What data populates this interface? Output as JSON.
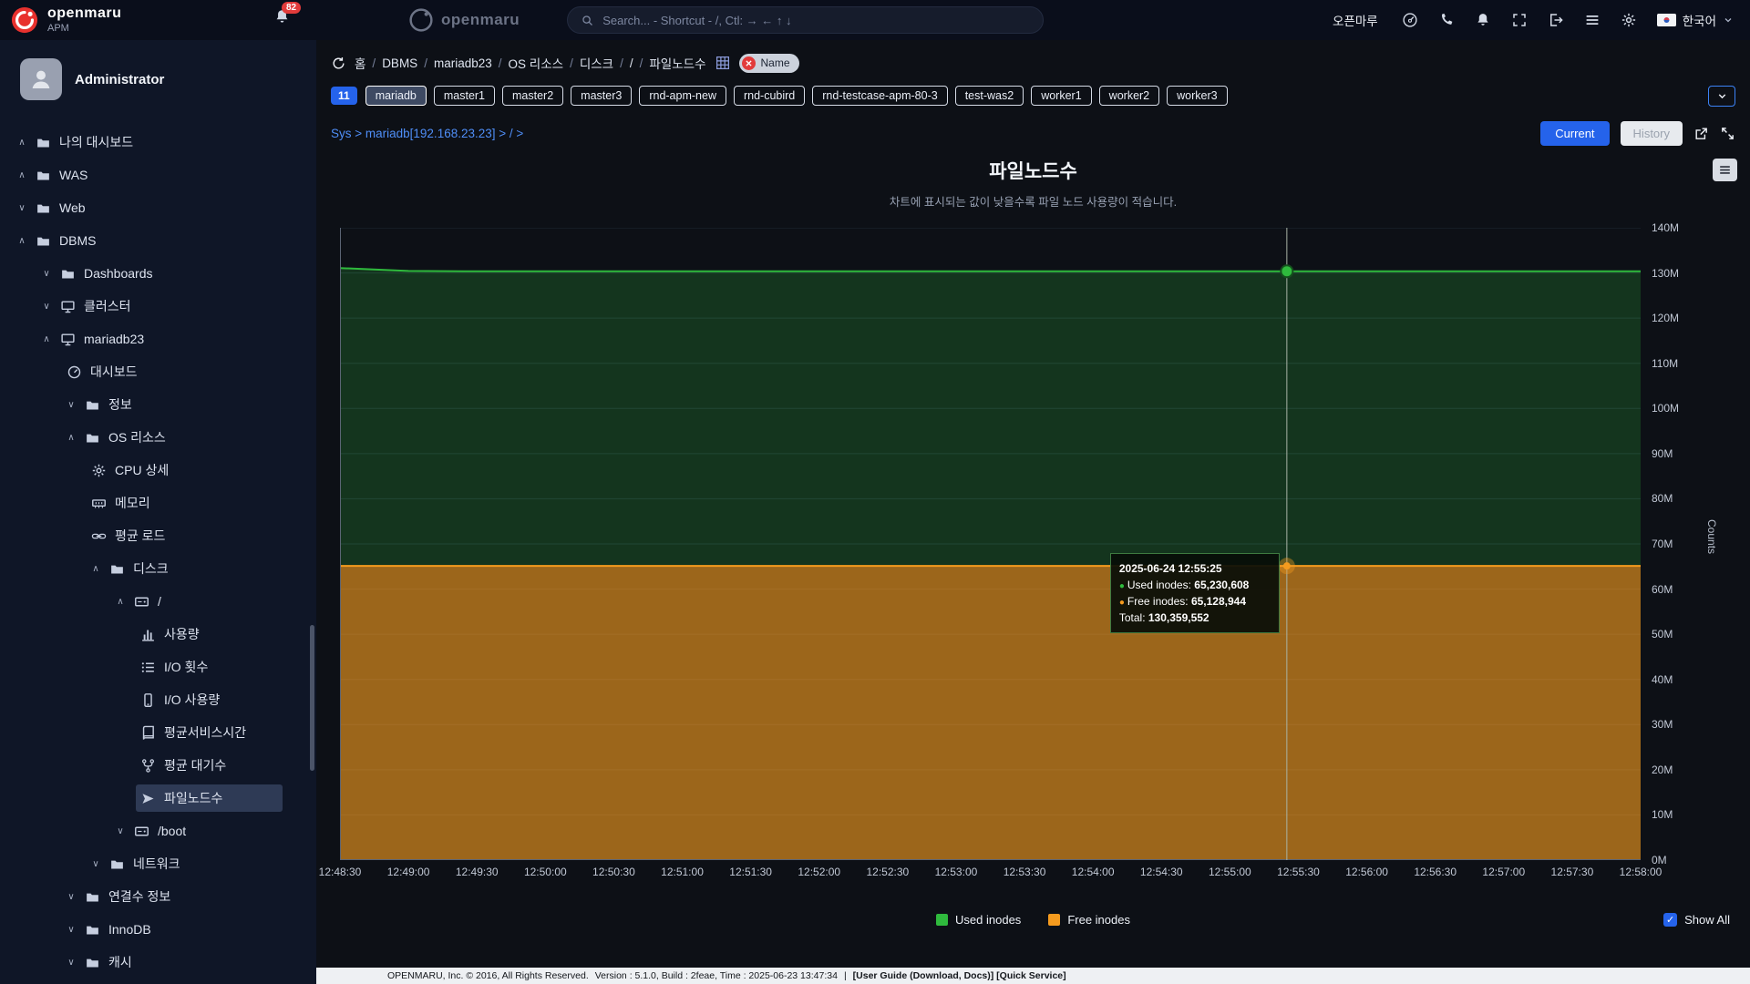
{
  "topbar": {
    "brand_name": "openmaru",
    "brand_sub": "APM",
    "notif_badge": "82",
    "center_brand": "openmaru",
    "search_placeholder": "Search... - Shortcut - /, Ctl: → ← ↑ ↓",
    "user_name": "오픈마루",
    "language": "한국어",
    "right_icons": [
      "speed",
      "phone",
      "bell",
      "apps",
      "signout",
      "menu",
      "gear"
    ]
  },
  "sidebar": {
    "user": "Administrator",
    "items": [
      {
        "label": "나의 대시보드",
        "level": 0,
        "chevron": "up",
        "icon": "folder"
      },
      {
        "label": "WAS",
        "level": 0,
        "chevron": "up",
        "icon": "folder"
      },
      {
        "label": "Web",
        "level": 0,
        "chevron": "down",
        "icon": "folder"
      },
      {
        "label": "DBMS",
        "level": 0,
        "chevron": "up",
        "icon": "folder"
      },
      {
        "label": "Dashboards",
        "level": 1,
        "chevron": "down",
        "icon": "folder"
      },
      {
        "label": "클러스터",
        "level": 1,
        "chevron": "down",
        "icon": "monitor"
      },
      {
        "label": "mariadb23",
        "level": 1,
        "chevron": "up",
        "icon": "monitor"
      },
      {
        "label": "대시보드",
        "level": 2,
        "chevron": null,
        "icon": "gauge"
      },
      {
        "label": "정보",
        "level": 2,
        "chevron": "down",
        "icon": "folder"
      },
      {
        "label": "OS 리소스",
        "level": 2,
        "chevron": "up",
        "icon": "folder"
      },
      {
        "label": "CPU 상세",
        "level": 3,
        "chevron": null,
        "icon": "gear"
      },
      {
        "label": "메모리",
        "level": 3,
        "chevron": null,
        "icon": "memory"
      },
      {
        "label": "평균 로드",
        "level": 3,
        "chevron": null,
        "icon": "link"
      },
      {
        "label": "디스크",
        "level": 3,
        "chevron": "up",
        "icon": "folder"
      },
      {
        "label": "/",
        "level": 4,
        "chevron": "up",
        "icon": "disk"
      },
      {
        "label": "사용량",
        "level": 5,
        "chevron": null,
        "icon": "chart"
      },
      {
        "label": "I/O 횟수",
        "level": 5,
        "chevron": null,
        "icon": "list"
      },
      {
        "label": "I/O 사용량",
        "level": 5,
        "chevron": null,
        "icon": "mobile"
      },
      {
        "label": "평균서비스시간",
        "level": 5,
        "chevron": null,
        "icon": "book"
      },
      {
        "label": "평균 대기수",
        "level": 5,
        "chevron": null,
        "icon": "fork"
      },
      {
        "label": "파일노드수",
        "level": 5,
        "chevron": null,
        "icon": "cursor",
        "selected": true
      },
      {
        "label": "/boot",
        "level": 4,
        "chevron": "down",
        "icon": "disk"
      },
      {
        "label": "네트워크",
        "level": 3,
        "chevron": "down",
        "icon": "folder"
      },
      {
        "label": "연결수 정보",
        "level": 2,
        "chevron": "down",
        "icon": "folder"
      },
      {
        "label": "InnoDB",
        "level": 2,
        "chevron": "down",
        "icon": "folder"
      },
      {
        "label": "캐시",
        "level": 2,
        "chevron": "down",
        "icon": "folder"
      }
    ]
  },
  "breadcrumb": {
    "items": [
      "홈",
      "DBMS",
      "mariadb23",
      "OS 리소스",
      "디스크",
      "/",
      "파일노드수"
    ],
    "filter_tag": "Name"
  },
  "tags": {
    "count": "11",
    "items": [
      {
        "label": "mariadb",
        "active": true
      },
      {
        "label": "master1"
      },
      {
        "label": "master2"
      },
      {
        "label": "master3"
      },
      {
        "label": "rnd-apm-new"
      },
      {
        "label": "rnd-cubird"
      },
      {
        "label": "rnd-testcase-apm-80-3"
      },
      {
        "label": "test-was2"
      },
      {
        "label": "worker1"
      },
      {
        "label": "worker2"
      },
      {
        "label": "worker3"
      }
    ]
  },
  "subnav": {
    "path": "Sys > mariadb[192.168.23.23] > / >",
    "current_label": "Current",
    "history_label": "History"
  },
  "colors": {
    "accent_blue": "#2563eb",
    "green": "#2fba3d",
    "orange": "#f59b1e",
    "badge_red": "#e23b3b"
  },
  "chart_data": {
    "type": "area",
    "stacked": true,
    "title": "파일노드수",
    "subtitle": "차트에 표시되는 값이 낮을수록 파일 노드 사용량이 적습니다.",
    "ylabel": "Counts",
    "ylim": [
      0,
      140000000
    ],
    "y_ticks": [
      "0M",
      "10M",
      "20M",
      "30M",
      "40M",
      "50M",
      "60M",
      "70M",
      "80M",
      "90M",
      "100M",
      "110M",
      "120M",
      "130M",
      "140M"
    ],
    "grid": true,
    "legend_position": "bottom",
    "x": [
      "12:48:30",
      "12:49:00",
      "12:49:30",
      "12:50:00",
      "12:50:30",
      "12:51:00",
      "12:51:30",
      "12:52:00",
      "12:52:30",
      "12:53:00",
      "12:53:30",
      "12:54:00",
      "12:54:30",
      "12:55:00",
      "12:55:30",
      "12:56:00",
      "12:56:30",
      "12:57:00",
      "12:57:30",
      "12:58:00"
    ],
    "series": [
      {
        "name": "Free inodes",
        "color": "#f59b1e",
        "values": [
          65128944,
          65128944,
          65128944,
          65128944,
          65128944,
          65128944,
          65128944,
          65128944,
          65128944,
          65128944,
          65128944,
          65128944,
          65128944,
          65128944,
          65128944,
          65128944,
          65128944,
          65128944,
          65128944,
          65128944
        ]
      },
      {
        "name": "Used inodes",
        "color": "#2fba3d",
        "values": [
          65950000,
          65300000,
          65230608,
          65230608,
          65230608,
          65230608,
          65230608,
          65230608,
          65230608,
          65230608,
          65230608,
          65230608,
          65230608,
          65230608,
          65230608,
          65230608,
          65230608,
          65230608,
          65230608,
          65230608
        ]
      }
    ],
    "legend": [
      "Used inodes",
      "Free inodes"
    ],
    "tooltip": {
      "time": "2025-06-24 12:55:25",
      "x_fraction": 0.728,
      "rows": [
        {
          "label": "Used inodes",
          "value": "65,230,608",
          "color": "#2fba3d"
        },
        {
          "label": "Free inodes",
          "value": "65,128,944",
          "color": "#f59b1e"
        }
      ],
      "total_label": "Total",
      "total": "130,359,552"
    },
    "show_all_label": "Show All"
  },
  "footer": {
    "text": "OPENMARU, Inc. © 2016, All Rights Reserved.",
    "meta": "Version : 5.1.0, Build : 2feae, Time : 2025-06-23 13:47:34",
    "separator": "|",
    "links": "[User Guide (Download, Docs)] [Quick Service]"
  }
}
